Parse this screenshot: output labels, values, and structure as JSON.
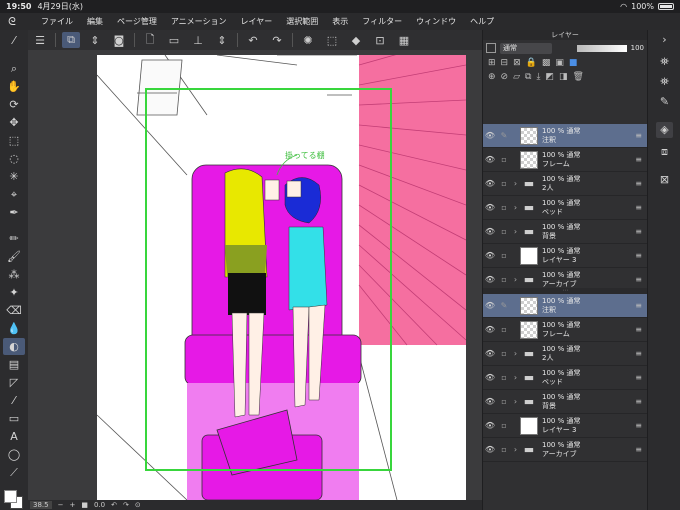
{
  "status": {
    "time": "19:50",
    "date": "4月29日(水)",
    "battery": "100%"
  },
  "menu": [
    "ファイル",
    "編集",
    "ページ管理",
    "アニメーション",
    "レイヤー",
    "選択範囲",
    "表示",
    "フィルター",
    "ウィンドウ",
    "ヘルプ"
  ],
  "canvas": {
    "annotation": "掛ってる棚",
    "zoom": "38.5",
    "rotation": "0.0"
  },
  "layer_panel": {
    "title": "レイヤー",
    "blend_mode": "通常",
    "opacity": "100",
    "groups": [
      {
        "layers": [
          {
            "kind": "trans",
            "expander": false,
            "pencil": true,
            "selected": true,
            "line1": "100 % 通常",
            "line2": "注釈"
          },
          {
            "kind": "trans",
            "expander": false,
            "pencil": false,
            "selected": false,
            "line1": "100 % 通常",
            "line2": "フレーム"
          },
          {
            "kind": "folder",
            "expander": true,
            "pencil": false,
            "selected": false,
            "line1": "100 % 通常",
            "line2": "2人"
          },
          {
            "kind": "folder",
            "expander": true,
            "pencil": false,
            "selected": false,
            "line1": "100 % 通常",
            "line2": "ベッド"
          },
          {
            "kind": "folder",
            "expander": true,
            "pencil": false,
            "selected": false,
            "line1": "100 % 通常",
            "line2": "背景"
          },
          {
            "kind": "white",
            "expander": false,
            "pencil": false,
            "selected": false,
            "line1": "100 % 通常",
            "line2": "レイヤー 3"
          },
          {
            "kind": "folder",
            "expander": true,
            "pencil": false,
            "selected": false,
            "line1": "100 % 通常",
            "line2": "アーカイブ"
          }
        ]
      },
      {
        "layers": [
          {
            "kind": "trans",
            "expander": false,
            "pencil": true,
            "selected": true,
            "line1": "100 % 通常",
            "line2": "注釈"
          },
          {
            "kind": "trans",
            "expander": false,
            "pencil": false,
            "selected": false,
            "line1": "100 % 通常",
            "line2": "フレーム"
          },
          {
            "kind": "folder",
            "expander": true,
            "pencil": false,
            "selected": false,
            "line1": "100 % 通常",
            "line2": "2人"
          },
          {
            "kind": "folder",
            "expander": true,
            "pencil": false,
            "selected": false,
            "line1": "100 % 通常",
            "line2": "ベッド"
          },
          {
            "kind": "folder",
            "expander": true,
            "pencil": false,
            "selected": false,
            "line1": "100 % 通常",
            "line2": "背景"
          },
          {
            "kind": "white",
            "expander": false,
            "pencil": false,
            "selected": false,
            "line1": "100 % 通常",
            "line2": "レイヤー 3"
          },
          {
            "kind": "folder",
            "expander": true,
            "pencil": false,
            "selected": false,
            "line1": "100 % 通常",
            "line2": "アーカイブ"
          }
        ]
      }
    ]
  },
  "colors": {
    "accent": "#5d6e8e",
    "frame": "#38d63c",
    "bed": "#e619e6",
    "curtain": "#f56fa0"
  }
}
